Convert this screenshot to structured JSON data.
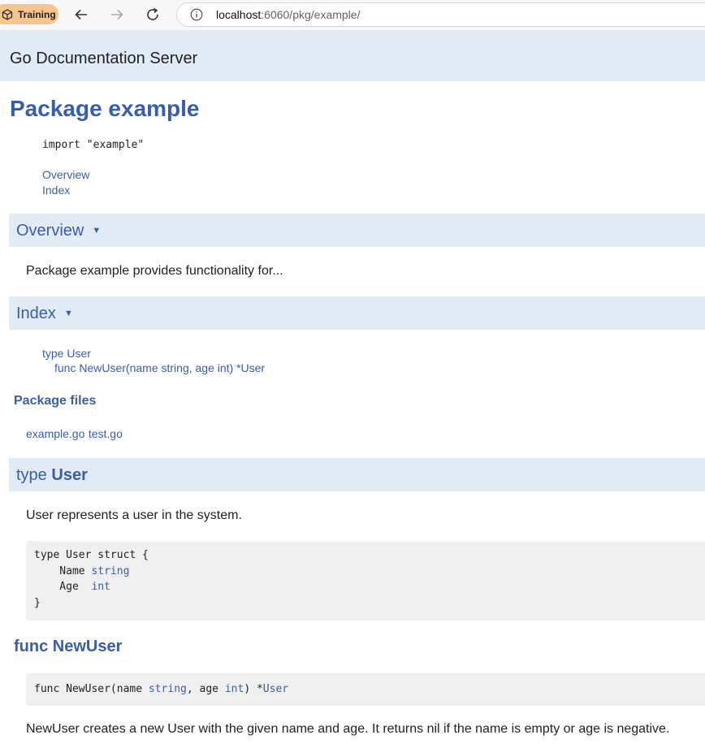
{
  "browser": {
    "profile_label": "Training",
    "url_host": "localhost",
    "url_path": ":6060/pkg/example/",
    "colors": {
      "profile_pill": "#f5c58d"
    }
  },
  "header": {
    "site_title": "Go Documentation Server",
    "bg_color": "#e0ebf5"
  },
  "page": {
    "title": "Package example",
    "import_line": "import \"example\"",
    "toc": [
      "Overview",
      "Index"
    ],
    "link_color": "#375eab"
  },
  "overview": {
    "heading": "Overview",
    "caret": "▼",
    "text": "Package example provides functionality for..."
  },
  "index": {
    "heading": "Index",
    "caret": "▼",
    "items": [
      "type User",
      "func NewUser(name string, age int) *User"
    ]
  },
  "package_files": {
    "heading": "Package files",
    "files": [
      "example.go",
      "test.go"
    ]
  },
  "type_user": {
    "heading_prefix": "type",
    "heading_name": "User",
    "description": "User represents a user in the system.",
    "code": {
      "line1": "type User struct {",
      "field1_name": "    Name ",
      "field1_type": "string",
      "field2_name": "    Age  ",
      "field2_type": "int",
      "line4": "}"
    }
  },
  "func_newuser": {
    "heading": "func NewUser",
    "signature": {
      "part1": "func NewUser(name ",
      "type1": "string",
      "part2": ", age ",
      "type2": "int",
      "part3": ") *",
      "type3": "User"
    },
    "description": "NewUser creates a new User with the given name and age. It returns nil if the name is empty or age is negative."
  }
}
